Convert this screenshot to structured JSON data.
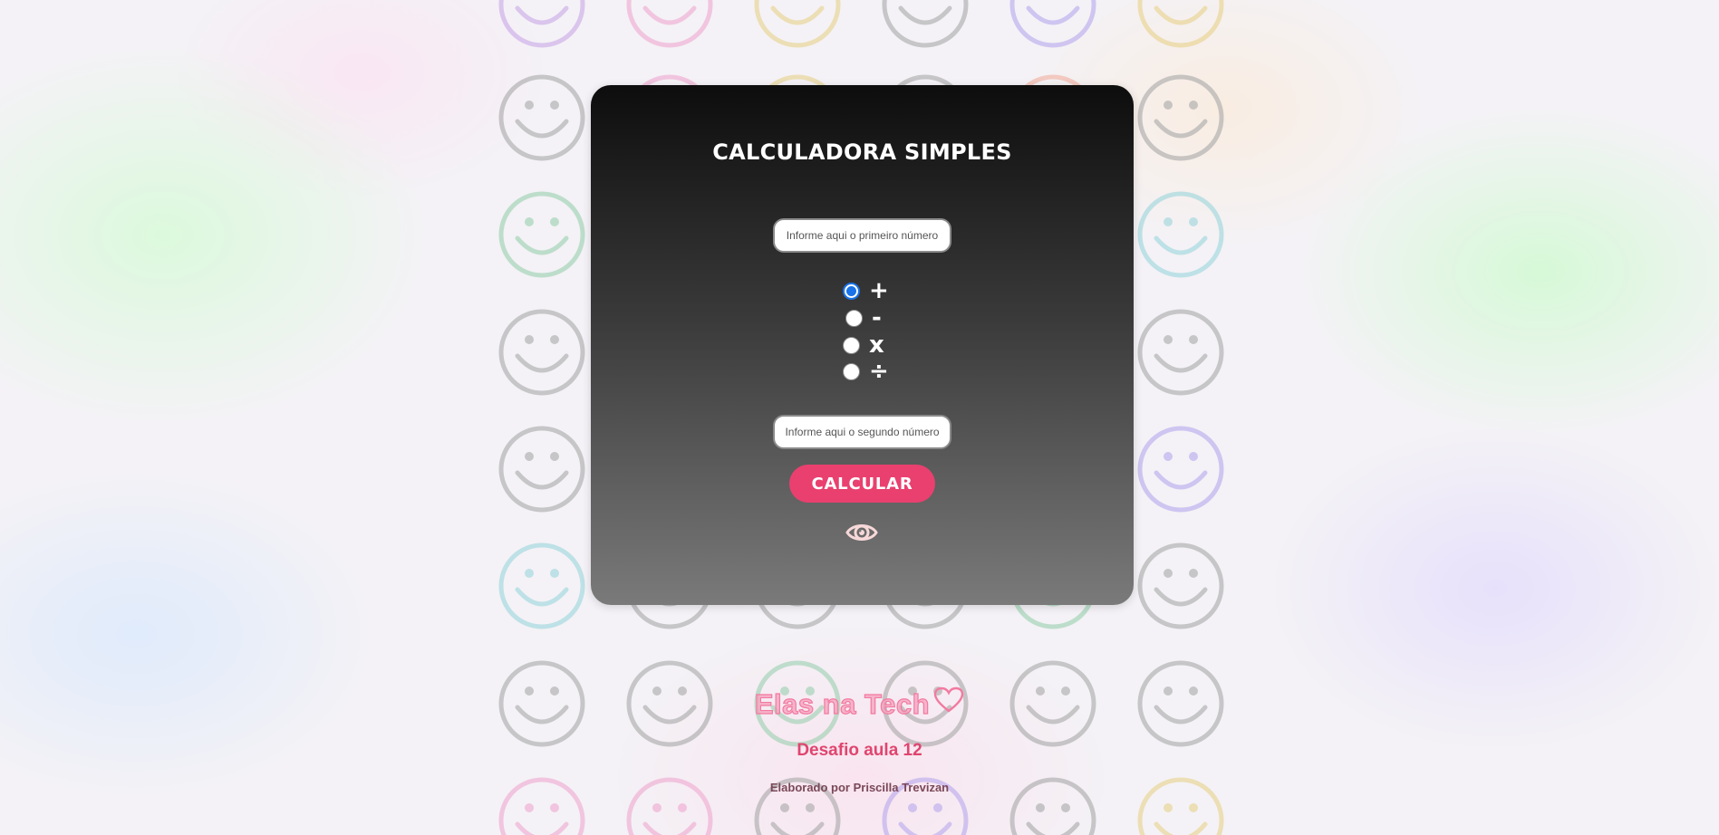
{
  "background": {
    "pattern_icon": "smiley-face-icon",
    "smiley_colors": [
      "#c9a8e8",
      "#f0a8d0",
      "#e8d28a",
      "#a8a8a8",
      "#9ad0b0",
      "#9ad6dc",
      "#b8a8ee",
      "#f2b0a0"
    ]
  },
  "calculator": {
    "title": "CALCULADORA SIMPLES",
    "first_input": {
      "placeholder": "Informe aqui o primeiro número",
      "value": ""
    },
    "operations": [
      {
        "symbol": "+",
        "checked": true
      },
      {
        "symbol": "-",
        "checked": false
      },
      {
        "symbol": "x",
        "checked": false
      },
      {
        "symbol": "÷",
        "checked": false
      }
    ],
    "second_input": {
      "placeholder": "Informe aqui o segundo número",
      "value": ""
    },
    "calculate_button": "CALCULAR",
    "result_icon": "eye-icon",
    "accent_color": "#e9406f"
  },
  "footer": {
    "brand": "Elas na Tech",
    "brand_icon": "heart-outline-icon",
    "subtitle": "Desafio aula 12",
    "credit": "Elaborado por Priscilla Trevizan"
  }
}
